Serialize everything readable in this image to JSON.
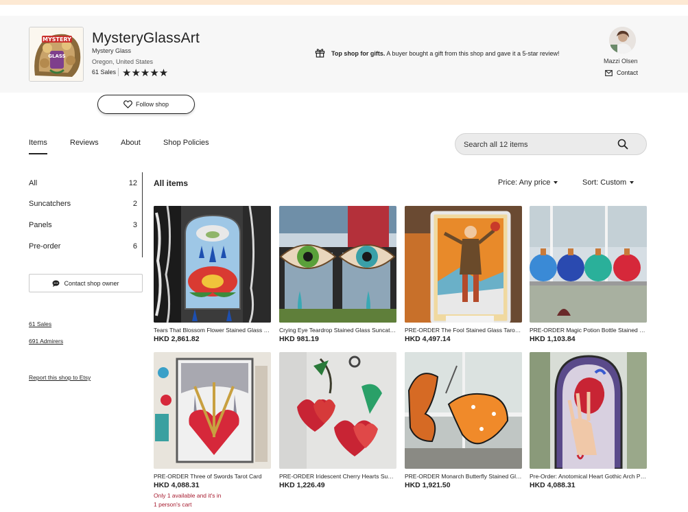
{
  "shop": {
    "name": "MysteryGlassArt",
    "subtitle": "Mystery Glass",
    "location": "Oregon, United States",
    "sales": "61 Sales",
    "rating_stars": "★★★★★",
    "gift_bold": "Top shop for gifts.",
    "gift_rest": " A buyer bought a gift from this shop and gave it a 5-star review!",
    "owner_name": "Mazzi Olsen",
    "contact_label": "Contact",
    "follow_label": "Follow shop"
  },
  "tabs": [
    {
      "label": "Items",
      "active": true
    },
    {
      "label": "Reviews",
      "active": false
    },
    {
      "label": "About",
      "active": false
    },
    {
      "label": "Shop Policies",
      "active": false
    }
  ],
  "search": {
    "placeholder": "Search all 12 items"
  },
  "sidebar": {
    "sections": [
      {
        "label": "All",
        "count": "12"
      },
      {
        "label": "Suncatchers",
        "count": "2"
      },
      {
        "label": "Panels",
        "count": "3"
      },
      {
        "label": "Pre-order",
        "count": "6"
      }
    ],
    "contact_owner": "Contact shop owner",
    "sales_link": "61 Sales",
    "admirers_link": "691 Admirers",
    "report_link": "Report this shop to Etsy"
  },
  "listing": {
    "title": "All items",
    "price_filter": "Price: Any price",
    "sort_filter": "Sort: Custom"
  },
  "items": [
    {
      "title": "Tears That Blossom Flower Stained Glass Suncatcher",
      "price": "HKD 2,861.82",
      "stock_1": "",
      "stock_2": "",
      "image": "tears-blossom"
    },
    {
      "title": "Crying Eye Teardrop Stained Glass Suncatcher",
      "price": "HKD 981.19",
      "stock_1": "",
      "stock_2": "",
      "image": "crying-eye"
    },
    {
      "title": "PRE-ORDER The Fool Stained Glass Tarot Card",
      "price": "HKD 4,497.14",
      "stock_1": "",
      "stock_2": "",
      "image": "the-fool"
    },
    {
      "title": "PRE-ORDER Magic Potion Bottle Stained Glass",
      "price": "HKD 1,103.84",
      "stock_1": "",
      "stock_2": "",
      "image": "potion-bottles"
    },
    {
      "title": "PRE-ORDER Three of Swords Tarot Card",
      "price": "HKD 4,088.31",
      "stock_1": "Only 1 available and it's in",
      "stock_2": "1 person's cart",
      "image": "three-of-swords"
    },
    {
      "title": "PRE-ORDER Iridescent Cherry Hearts Suncatcher",
      "price": "HKD 1,226.49",
      "stock_1": "",
      "stock_2": "",
      "image": "cherry-hearts"
    },
    {
      "title": "PRE-ORDER Monarch Butterfly Stained Glass",
      "price": "HKD 1,921.50",
      "stock_1": "",
      "stock_2": "",
      "image": "monarch-butterfly"
    },
    {
      "title": "Pre-Order: Anotomical Heart Gothic Arch Panel",
      "price": "HKD 4,088.31",
      "stock_1": "",
      "stock_2": "",
      "image": "anatomical-heart"
    }
  ]
}
